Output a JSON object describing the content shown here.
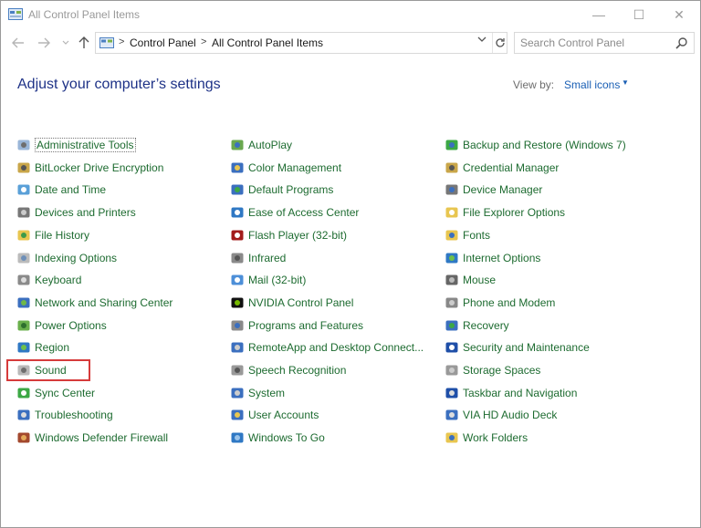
{
  "window": {
    "title": "All Control Panel Items",
    "controls": {
      "minimize": "—",
      "maximize": "☐",
      "close": "✕"
    }
  },
  "nav": {
    "back_icon": "arrow-left-icon",
    "forward_icon": "arrow-right-icon",
    "up_icon": "arrow-up-icon",
    "breadcrumb": [
      "Control Panel",
      "All Control Panel Items"
    ],
    "search_placeholder": "Search Control Panel"
  },
  "header": {
    "title": "Adjust your computer’s settings",
    "view_by_label": "View by:",
    "view_by_value": "Small icons"
  },
  "items": {
    "col1": [
      {
        "label": "Administrative Tools",
        "icon": "admin-tools-icon"
      },
      {
        "label": "BitLocker Drive Encryption",
        "icon": "bitlocker-icon"
      },
      {
        "label": "Date and Time",
        "icon": "clock-icon"
      },
      {
        "label": "Devices and Printers",
        "icon": "printer-icon"
      },
      {
        "label": "File History",
        "icon": "file-history-icon"
      },
      {
        "label": "Indexing Options",
        "icon": "indexing-icon"
      },
      {
        "label": "Keyboard",
        "icon": "keyboard-icon"
      },
      {
        "label": "Network and Sharing Center",
        "icon": "network-icon"
      },
      {
        "label": "Power Options",
        "icon": "power-icon"
      },
      {
        "label": "Region",
        "icon": "globe-icon"
      },
      {
        "label": "Sound",
        "icon": "speaker-icon"
      },
      {
        "label": "Sync Center",
        "icon": "sync-icon"
      },
      {
        "label": "Troubleshooting",
        "icon": "troubleshoot-icon"
      },
      {
        "label": "Windows Defender Firewall",
        "icon": "firewall-icon"
      }
    ],
    "col2": [
      {
        "label": "AutoPlay",
        "icon": "autoplay-icon"
      },
      {
        "label": "Color Management",
        "icon": "color-icon"
      },
      {
        "label": "Default Programs",
        "icon": "default-programs-icon"
      },
      {
        "label": "Ease of Access Center",
        "icon": "ease-access-icon"
      },
      {
        "label": "Flash Player (32-bit)",
        "icon": "flash-icon"
      },
      {
        "label": "Infrared",
        "icon": "infrared-icon"
      },
      {
        "label": "Mail (32-bit)",
        "icon": "mail-icon"
      },
      {
        "label": "NVIDIA Control Panel",
        "icon": "nvidia-icon"
      },
      {
        "label": "Programs and Features",
        "icon": "programs-icon"
      },
      {
        "label": "RemoteApp and Desktop Connect...",
        "icon": "remoteapp-icon"
      },
      {
        "label": "Speech Recognition",
        "icon": "microphone-icon"
      },
      {
        "label": "System",
        "icon": "system-icon"
      },
      {
        "label": "User Accounts",
        "icon": "users-icon"
      },
      {
        "label": "Windows To Go",
        "icon": "windows-to-go-icon"
      }
    ],
    "col3": [
      {
        "label": "Backup and Restore (Windows 7)",
        "icon": "backup-icon"
      },
      {
        "label": "Credential Manager",
        "icon": "credential-icon"
      },
      {
        "label": "Device Manager",
        "icon": "device-manager-icon"
      },
      {
        "label": "File Explorer Options",
        "icon": "folder-options-icon"
      },
      {
        "label": "Fonts",
        "icon": "fonts-icon"
      },
      {
        "label": "Internet Options",
        "icon": "internet-icon"
      },
      {
        "label": "Mouse",
        "icon": "mouse-icon"
      },
      {
        "label": "Phone and Modem",
        "icon": "phone-icon"
      },
      {
        "label": "Recovery",
        "icon": "recovery-icon"
      },
      {
        "label": "Security and Maintenance",
        "icon": "flag-icon"
      },
      {
        "label": "Storage Spaces",
        "icon": "storage-icon"
      },
      {
        "label": "Taskbar and Navigation",
        "icon": "taskbar-icon"
      },
      {
        "label": "VIA HD Audio Deck",
        "icon": "audio-deck-icon"
      },
      {
        "label": "Work Folders",
        "icon": "work-folders-icon"
      }
    ]
  },
  "colors": {
    "link": "#1d6b30",
    "heading": "#1e3287",
    "highlight": "#d63b3b",
    "accent_link": "#1a5fb4"
  }
}
